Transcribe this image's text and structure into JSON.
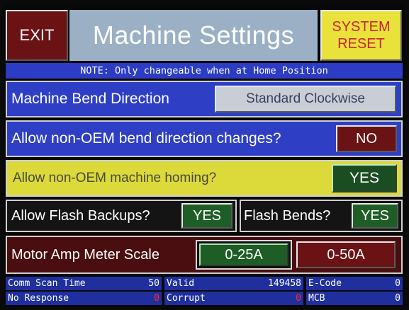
{
  "header": {
    "exit_label": "EXIT",
    "title": "Machine Settings",
    "reset_line1": "SYSTEM",
    "reset_line2": "RESET"
  },
  "note": "NOTE: Only changeable when at Home Position",
  "settings": {
    "bend_direction": {
      "label": "Machine Bend Direction",
      "value": "Standard Clockwise"
    },
    "nonoem_bend": {
      "label": "Allow non-OEM bend direction changes?",
      "value": "NO"
    },
    "nonoem_homing": {
      "label": "Allow non-OEM machine homing?",
      "value": "YES"
    },
    "flash_backups": {
      "label": "Allow Flash Backups?",
      "value": "YES"
    },
    "flash_bends": {
      "label": "Flash Bends?",
      "value": "YES"
    },
    "amp_scale": {
      "label": "Motor Amp Meter Scale",
      "option1": "0-25A",
      "option2": "0-50A",
      "selected": "0-25A"
    }
  },
  "status": {
    "comm_scan": {
      "label": "Comm Scan Time",
      "value": "50"
    },
    "valid": {
      "label": "Valid",
      "value": "149458"
    },
    "ecode": {
      "label": "E-Code",
      "value": "0"
    },
    "no_response": {
      "label": "No Response",
      "value": "0"
    },
    "corrupt": {
      "label": "Corrupt",
      "value": "0"
    },
    "mcb": {
      "label": "MCB",
      "value": "0"
    }
  },
  "colors": {
    "exit": "#6b1214",
    "title_bg": "#9bb0c4",
    "reset_bg": "#e8e23a",
    "reset_text": "#c8252d",
    "blue_row": "#2e3fc6",
    "yellow_row": "#dcd93a",
    "yes_green": "#1f5d27",
    "no_red": "#6b1214",
    "status_blue": "#1f2f9e",
    "error_red": "#ff2a2a"
  }
}
